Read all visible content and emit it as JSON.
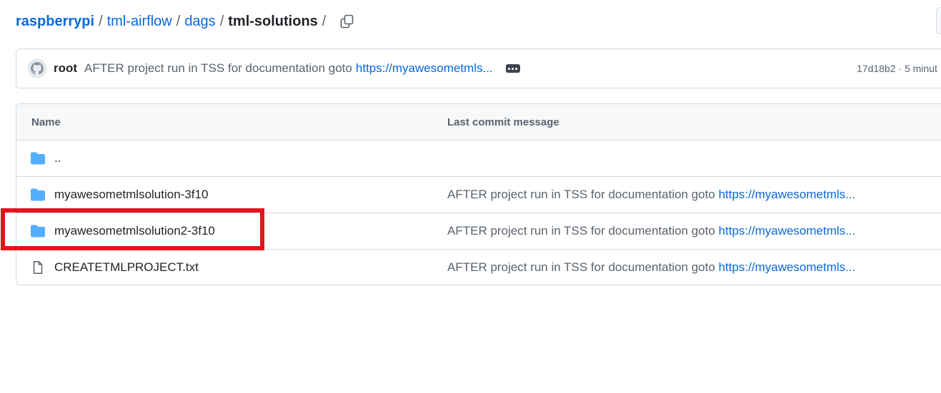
{
  "breadcrumb": {
    "repo": "raspberrypi",
    "path": [
      "tml-airflow",
      "dags"
    ],
    "current": "tml-solutions",
    "separator": "/"
  },
  "latest_commit": {
    "author": "root",
    "message": "AFTER project run in TSS for documentation goto",
    "link": "https://myawesometmls...",
    "meta": "17d18b2 · 5 minut"
  },
  "file_table": {
    "headers": {
      "name": "Name",
      "last_commit_message": "Last commit message"
    },
    "rows": [
      {
        "name": "..",
        "type": "folder",
        "message": "",
        "link": ""
      },
      {
        "name": "myawesometmlsolution-3f10",
        "type": "folder",
        "message": "AFTER project run in TSS for documentation goto",
        "link": "https://myawesometmls..."
      },
      {
        "name": "myawesometmlsolution2-3f10",
        "type": "folder",
        "message": "AFTER project run in TSS for documentation goto",
        "link": "https://myawesometmls..."
      },
      {
        "name": "CREATETMLPROJECT.txt",
        "type": "file",
        "message": "AFTER project run in TSS for documentation goto",
        "link": "https://myawesometmls..."
      }
    ]
  },
  "colors": {
    "link": "#0969da",
    "folder_icon": "#54aeff",
    "highlight": "#e3141b",
    "border": "#d1d9e0",
    "header_bg": "#f6f8fa"
  },
  "icons": {
    "copy": "copy-icon",
    "avatar": "github-avatar-icon",
    "folder": "folder-icon",
    "file": "file-icon",
    "ellipsis": "ellipsis-icon"
  }
}
